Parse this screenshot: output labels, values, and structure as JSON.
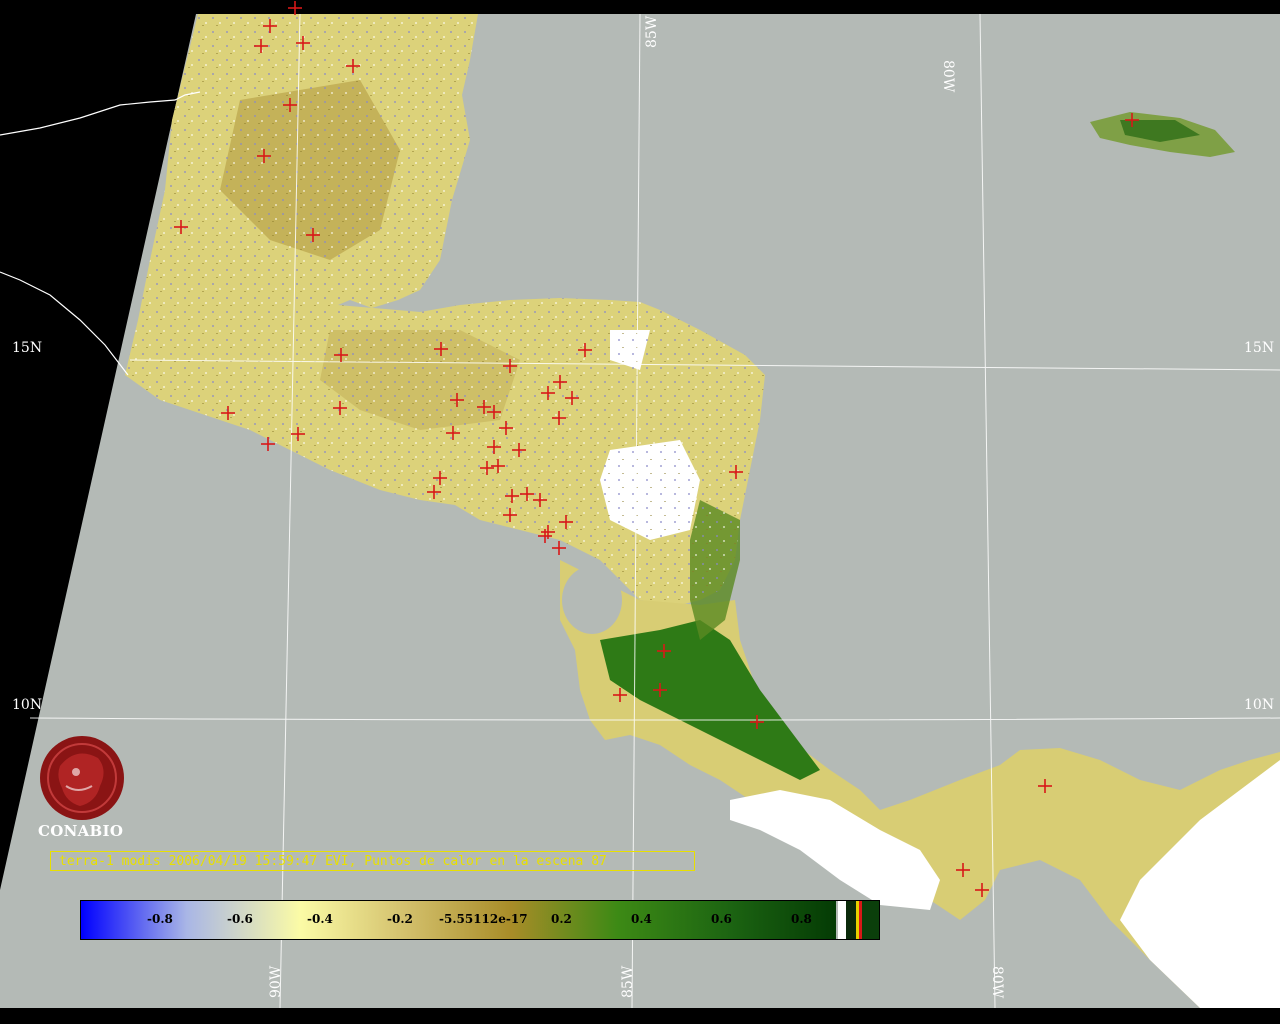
{
  "caption": "terra-1 modis 2006/04/19 15:59:47 EVI, Puntos de calor en la escena 87",
  "logo": {
    "name": "CONABIO"
  },
  "grid": {
    "lat_labels": [
      "15N",
      "15N",
      "10N",
      "10N"
    ],
    "lon_labels": [
      "85W",
      "80W",
      "90W",
      "85W",
      "80W"
    ]
  },
  "colorbar": {
    "ticks": [
      "-0.8",
      "-0.6",
      "-0.4",
      "-0.2",
      "-5.55112e-17",
      "0.2",
      "0.4",
      "0.6",
      "0.8"
    ],
    "colors": [
      "#0000ff",
      "#a9b6e6",
      "#fbfba6",
      "#d3c06c",
      "#a88c28",
      "#3d8a15",
      "#1c6412",
      "#043b04"
    ]
  },
  "colors": {
    "ocean": "#b4bab6",
    "background": "#000000",
    "hotspot": "#d81818",
    "grid": "#ffffff",
    "cloud": "#ffffff"
  }
}
